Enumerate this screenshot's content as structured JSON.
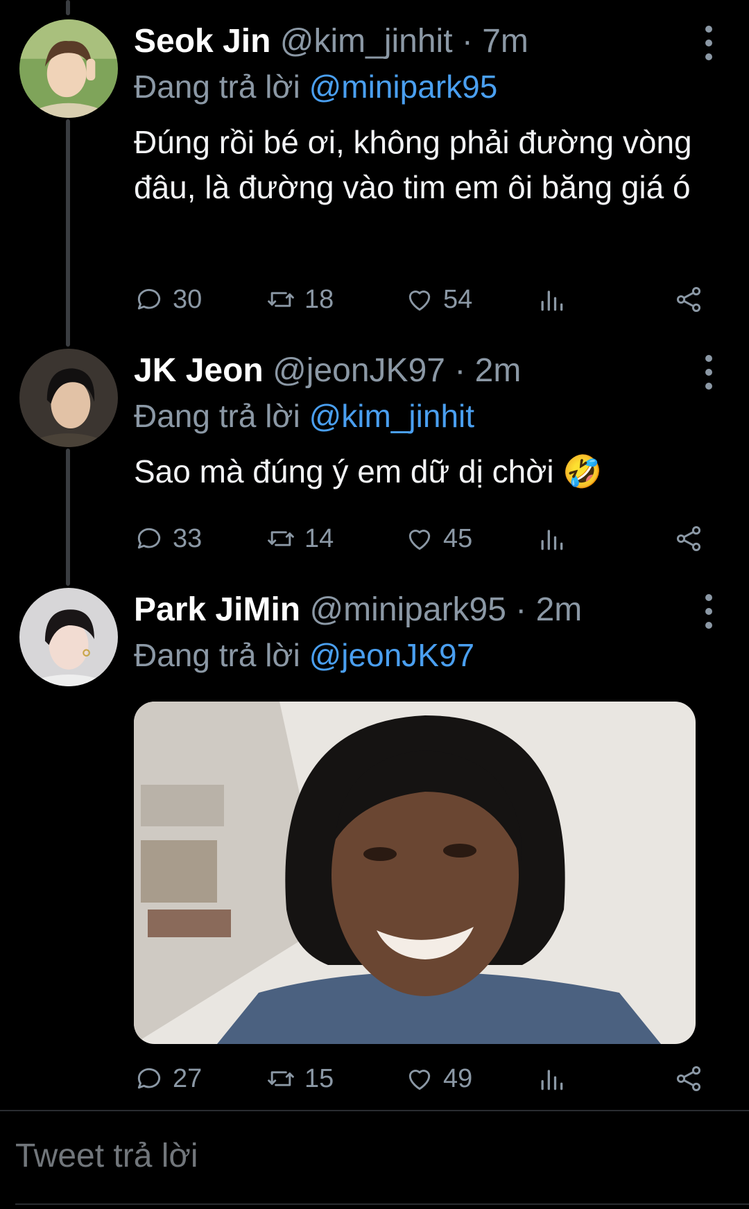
{
  "tweets": [
    {
      "display_name": "Seok Jin",
      "handle": "@kim_jinhit",
      "separator": "·",
      "time": "7m",
      "reply_prefix": "Đang trả lời",
      "reply_to": "@minipark95",
      "text": "Đúng rồi bé ơi, không phải đường vòng đâu, là đường vào tim em ôi băng giá ó",
      "replies": "30",
      "retweets": "18",
      "likes": "54"
    },
    {
      "display_name": "JK Jeon",
      "handle": "@jeonJK97",
      "separator": "·",
      "time": "2m",
      "reply_prefix": "Đang trả lời",
      "reply_to": "@kim_jinhit",
      "text": "Sao mà đúng ý em dữ dị chời 🤣",
      "replies": "33",
      "retweets": "14",
      "likes": "45"
    },
    {
      "display_name": "Park JiMin",
      "handle": "@minipark95",
      "separator": "·",
      "time": "2m",
      "reply_prefix": "Đang trả lời",
      "reply_to": "@jeonJK97",
      "text": "",
      "replies": "27",
      "retweets": "15",
      "likes": "49"
    }
  ],
  "composer": {
    "placeholder": "Tweet trả lời"
  },
  "icons": {
    "reply": "comment-icon",
    "retweet": "retweet-icon",
    "like": "heart-icon",
    "views": "analytics-icon",
    "share": "share-icon",
    "more": "more-vertical-icon"
  },
  "colors": {
    "background": "#000000",
    "text_primary": "#ffffff",
    "text_secondary": "#8b98a5",
    "mention": "#4a9ff0",
    "thread_line": "#3a3d41"
  }
}
